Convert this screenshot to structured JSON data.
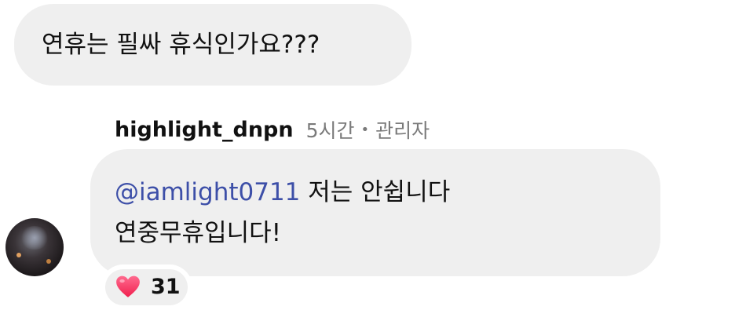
{
  "comment": {
    "text": "연휴는 필싸 휴식인가요???"
  },
  "reply": {
    "username": "highlight_dnpn",
    "time": "5시간",
    "separator": "•",
    "role": "관리자",
    "mention": "@iamlight0711",
    "line1_rest": " 저는 안쉽니다",
    "line2": "연중무휴입니다!",
    "avatar_icon": "user-avatar-icon"
  },
  "reaction": {
    "icon": "heart-icon",
    "count": "31",
    "color": "#ff3e6c"
  },
  "colors": {
    "bubble": "#efefef",
    "mention": "#3d4fa8",
    "meta": "#7a7a7a"
  }
}
